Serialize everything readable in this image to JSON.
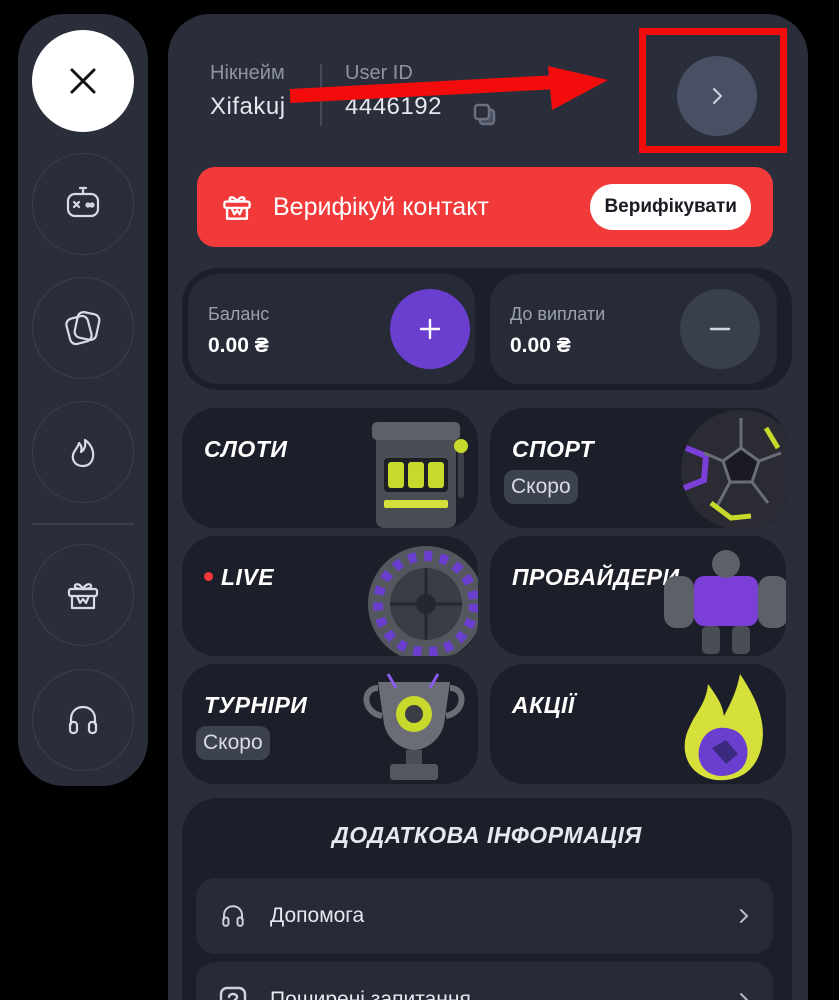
{
  "rail": {
    "items": [
      {
        "name": "close-icon"
      },
      {
        "name": "gamepad-icon"
      },
      {
        "name": "cards-icon"
      },
      {
        "name": "flame-icon"
      },
      {
        "name": "gift-icon"
      },
      {
        "name": "headset-icon"
      }
    ]
  },
  "profile": {
    "nickname_label": "Нікнейм",
    "nickname": "Xifakuj",
    "userid_label": "User ID",
    "userid": "4446192"
  },
  "verify": {
    "text": "Верифікуй контакт",
    "button": "Верифікувати",
    "color": "#f23a3a"
  },
  "balance": {
    "label": "Баланс",
    "value": "0.00 ₴"
  },
  "payout": {
    "label": "До виплати",
    "value": "0.00 ₴"
  },
  "tiles": {
    "slots": {
      "title": "СЛОТИ"
    },
    "sport": {
      "title": "СПОРТ",
      "badge": "Скоро"
    },
    "live": {
      "title": "LIVE"
    },
    "providers": {
      "title": "ПРОВАЙДЕРИ"
    },
    "tournaments": {
      "title": "ТУРНІРИ",
      "badge": "Скоро"
    },
    "promos": {
      "title": "АКЦІЇ"
    }
  },
  "info": {
    "title": "ДОДАТКОВА ІНФОРМАЦІЯ",
    "items": [
      {
        "label": "Допомога",
        "icon": "headset-icon"
      },
      {
        "label": "Поширені запитання",
        "icon": "question-icon"
      }
    ]
  },
  "accent": {
    "purple": "#6a3fd0",
    "annotation": "#f20c0c"
  }
}
